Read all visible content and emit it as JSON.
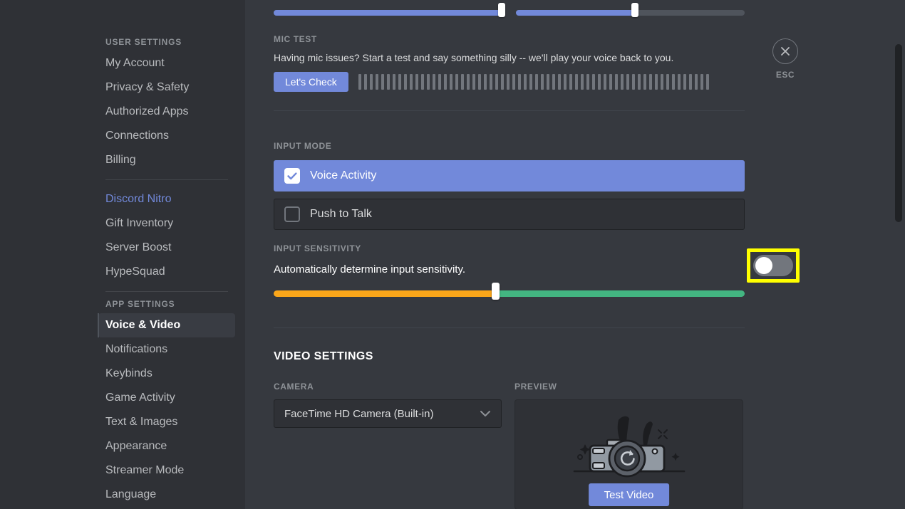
{
  "window": {
    "traffic_lights": [
      {
        "name": "close",
        "color": "#ff5f57"
      },
      {
        "name": "minimize",
        "color": "#febc2e"
      },
      {
        "name": "zoom",
        "color": "#28c840"
      }
    ]
  },
  "sidebar": {
    "user_settings_header": "USER SETTINGS",
    "user_items": [
      {
        "label": "My Account"
      },
      {
        "label": "Privacy & Safety"
      },
      {
        "label": "Authorized Apps"
      },
      {
        "label": "Connections"
      },
      {
        "label": "Billing"
      }
    ],
    "nitro_items": [
      {
        "label": "Discord Nitro",
        "accent": "#7289da"
      },
      {
        "label": "Gift Inventory"
      },
      {
        "label": "Server Boost"
      },
      {
        "label": "HypeSquad"
      }
    ],
    "app_settings_header": "APP SETTINGS",
    "app_items": [
      {
        "label": "Voice & Video",
        "active": true
      },
      {
        "label": "Notifications"
      },
      {
        "label": "Keybinds"
      },
      {
        "label": "Game Activity"
      },
      {
        "label": "Text & Images"
      },
      {
        "label": "Appearance"
      },
      {
        "label": "Streamer Mode"
      },
      {
        "label": "Language"
      }
    ]
  },
  "volume_sliders": {
    "input_volume": {
      "percent": 100,
      "accent": "#7289da"
    },
    "output_volume": {
      "percent": 52,
      "accent": "#7289da"
    }
  },
  "mic_test": {
    "label": "MIC TEST",
    "description": "Having mic issues? Start a test and say something silly -- we'll play your voice back to you.",
    "button_label": "Let's Check",
    "level_segments": 62,
    "segment_color": "#72767d"
  },
  "input_mode": {
    "label": "INPUT MODE",
    "options": [
      {
        "label": "Voice Activity",
        "selected": true
      },
      {
        "label": "Push to Talk",
        "selected": false
      }
    ],
    "selected_color": "#7289da"
  },
  "input_sensitivity": {
    "label": "INPUT SENSITIVITY",
    "description": "Automatically determine input sensitivity.",
    "toggle": {
      "state": "off",
      "track_color": "#72767d",
      "knob_color": "#ffffff"
    },
    "highlight_color": "#ffff00",
    "slider": {
      "handle_percent": 47,
      "warm_color": "#faa61a",
      "cool_color": "#43b581"
    }
  },
  "video_settings": {
    "title": "VIDEO SETTINGS",
    "camera_label": "CAMERA",
    "camera_value": "FaceTime HD Camera (Built-in)",
    "preview_label": "PREVIEW",
    "test_video_label": "Test Video"
  },
  "esc": {
    "label": "ESC"
  }
}
